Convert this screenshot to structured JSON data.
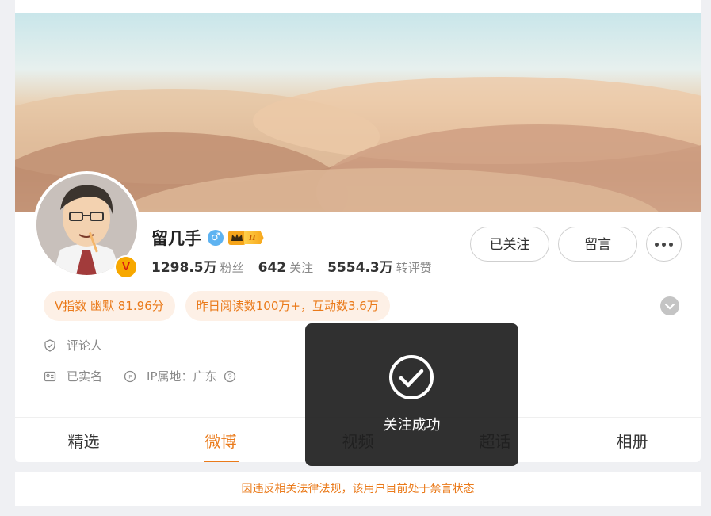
{
  "profile": {
    "name": "留几手",
    "gender_symbol": "♂",
    "level_label": "II",
    "stats": [
      {
        "num": "1298.5万",
        "label": "粉丝"
      },
      {
        "num": "642",
        "label": "关注"
      },
      {
        "num": "5554.3万",
        "label": "转评赞"
      }
    ],
    "verify_letter": "V"
  },
  "actions": {
    "follow_label": "已关注",
    "message_label": "留言"
  },
  "tags": [
    "V指数 幽默 81.96分",
    "昨日阅读数100万+，互动数3.6万"
  ],
  "info": {
    "role": "评论人",
    "realname": "已实名",
    "ip": "IP属地：广东"
  },
  "tabs": [
    "精选",
    "微博",
    "视频",
    "超话",
    "相册"
  ],
  "active_tab": "微博",
  "notice": "因违反相关法律法规，该用户目前处于禁言状态",
  "toast": "关注成功",
  "colors": {
    "accent": "#ea7a1a",
    "tag_bg": "#fdf0e6",
    "toast_bg": "#1e1e1e"
  }
}
